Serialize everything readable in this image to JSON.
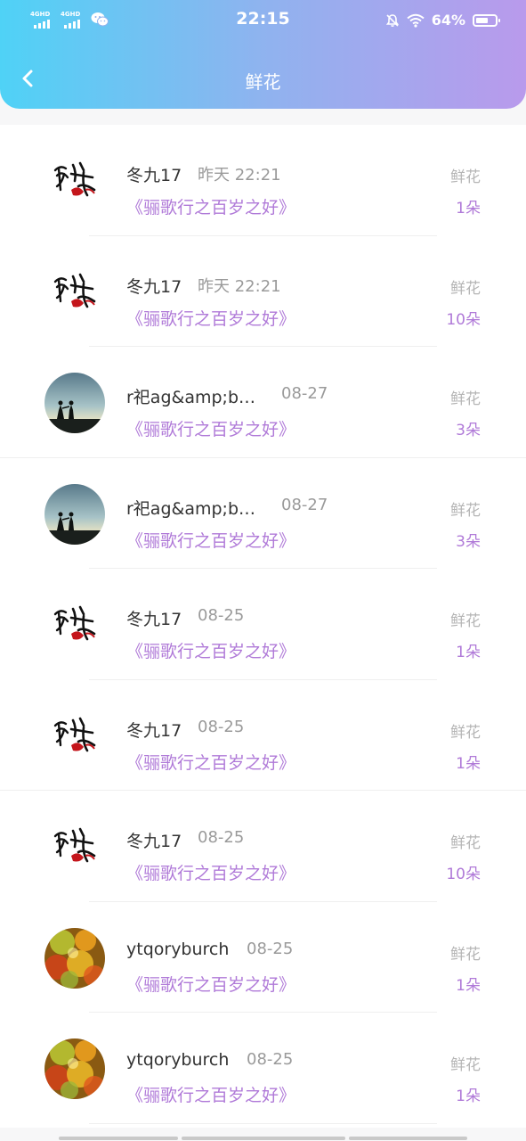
{
  "status_bar": {
    "network_1": "4GHD",
    "network_2": "4GHD",
    "time": "22:15",
    "battery": "64%",
    "battery_level": 0.64
  },
  "header": {
    "title": "鲜花",
    "back_icon": "chevron-left-icon"
  },
  "records": [
    {
      "avatar": "calligraphy",
      "name": "冬九17",
      "time": "昨天 22:21",
      "book": "《骊歌行之百岁之好》",
      "gift_type": "鲜花",
      "gift_count": "1朵"
    },
    {
      "avatar": "calligraphy",
      "name": "冬九17",
      "time": "昨天 22:21",
      "book": "《骊歌行之百岁之好》",
      "gift_type": "鲜花",
      "gift_count": "10朵"
    },
    {
      "avatar": "couple-silhouette",
      "name": "r祀ag&amp;b…",
      "time": "08-27",
      "book": "《骊歌行之百岁之好》",
      "gift_type": "鲜花",
      "gift_count": "3朵"
    },
    {
      "avatar": "couple-silhouette",
      "name": "r祀ag&amp;b…",
      "time": "08-27",
      "book": "《骊歌行之百岁之好》",
      "gift_type": "鲜花",
      "gift_count": "3朵"
    },
    {
      "avatar": "calligraphy",
      "name": "冬九17",
      "time": "08-25",
      "book": "《骊歌行之百岁之好》",
      "gift_type": "鲜花",
      "gift_count": "1朵"
    },
    {
      "avatar": "calligraphy",
      "name": "冬九17",
      "time": "08-25",
      "book": "《骊歌行之百岁之好》",
      "gift_type": "鲜花",
      "gift_count": "1朵"
    },
    {
      "avatar": "calligraphy",
      "name": "冬九17",
      "time": "08-25",
      "book": "《骊歌行之百岁之好》",
      "gift_type": "鲜花",
      "gift_count": "10朵"
    },
    {
      "avatar": "bokeh",
      "name": "ytqoryburch",
      "time": "08-25",
      "book": "《骊歌行之百岁之好》",
      "gift_type": "鲜花",
      "gift_count": "1朵"
    },
    {
      "avatar": "bokeh",
      "name": "ytqoryburch",
      "time": "08-25",
      "book": "《骊歌行之百岁之好》",
      "gift_type": "鲜花",
      "gift_count": "1朵"
    }
  ],
  "colors": {
    "header_gradient": [
      "#4fd2f6",
      "#b99aec"
    ],
    "accent": "#b07ad8",
    "muted": "#9a9a9a"
  }
}
